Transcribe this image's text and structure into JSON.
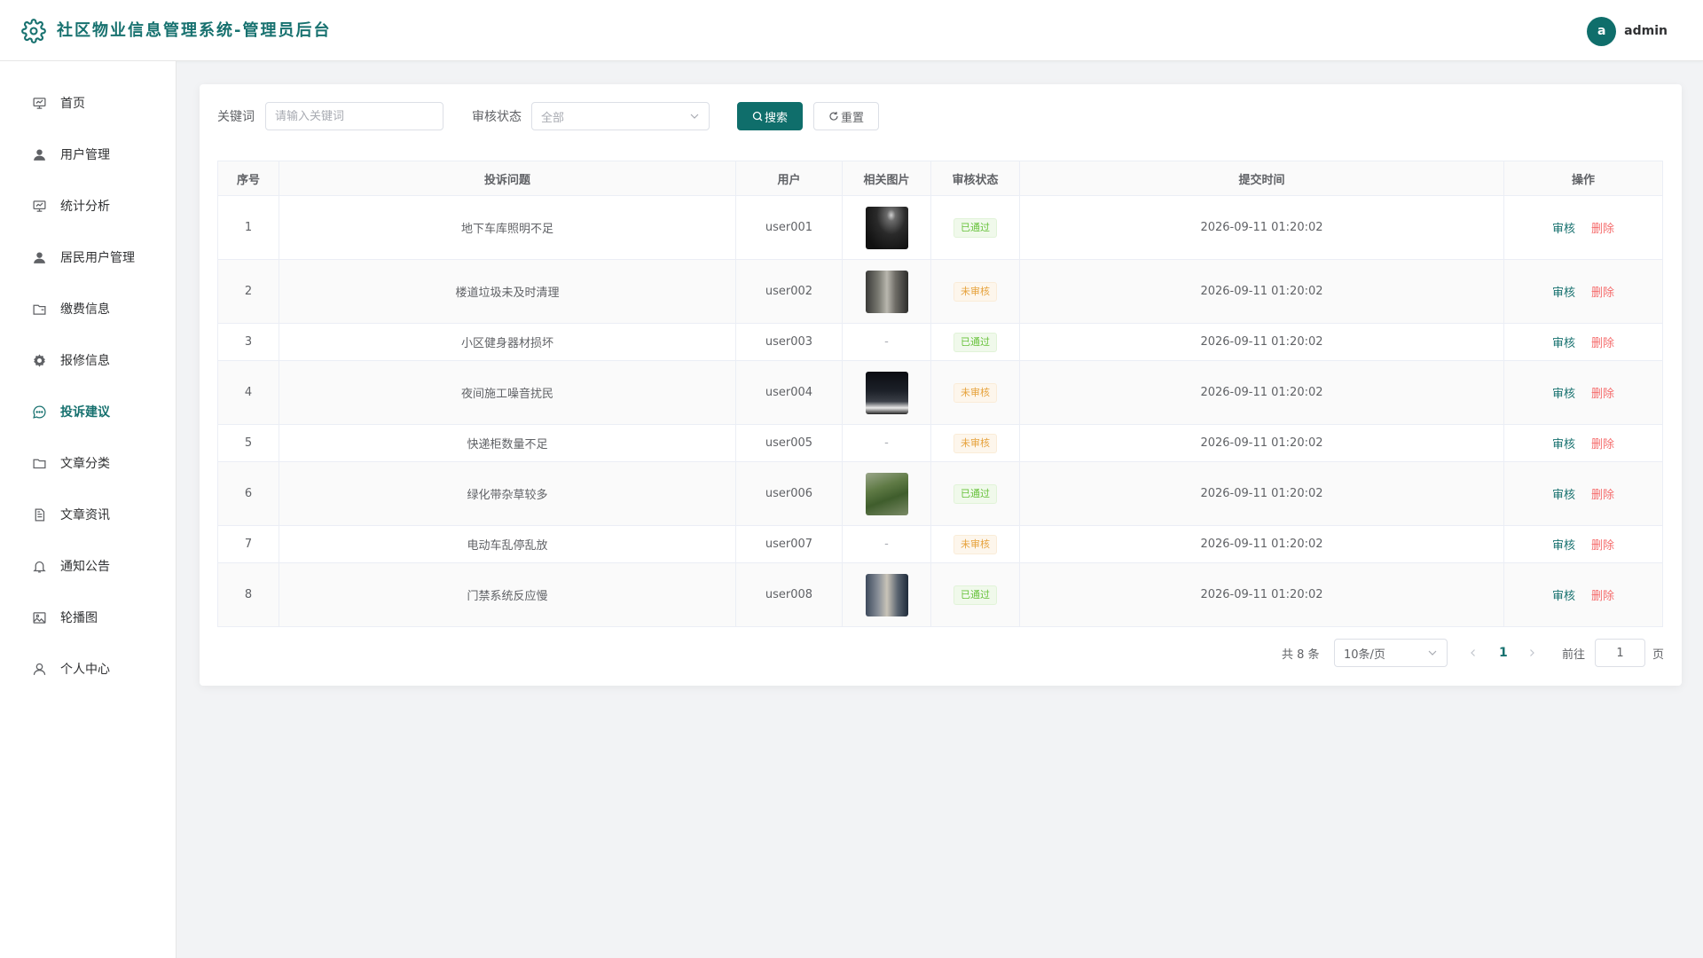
{
  "header": {
    "title": "社区物业信息管理系统-管理员后台",
    "avatar_letter": "a",
    "username": "admin",
    "accent": "#17716f"
  },
  "sidebar": {
    "items": [
      {
        "label": "首页",
        "icon": "monitor-icon"
      },
      {
        "label": "用户管理",
        "icon": "user-icon"
      },
      {
        "label": "统计分析",
        "icon": "chart-icon"
      },
      {
        "label": "居民用户管理",
        "icon": "user-icon"
      },
      {
        "label": "缴费信息",
        "icon": "wallet-icon"
      },
      {
        "label": "报修信息",
        "icon": "gear-icon"
      },
      {
        "label": "投诉建议",
        "icon": "chat-icon",
        "active": true
      },
      {
        "label": "文章分类",
        "icon": "folder-icon"
      },
      {
        "label": "文章资讯",
        "icon": "document-icon"
      },
      {
        "label": "通知公告",
        "icon": "bell-icon"
      },
      {
        "label": "轮播图",
        "icon": "picture-icon"
      },
      {
        "label": "个人中心",
        "icon": "user-outline-icon"
      }
    ]
  },
  "filters": {
    "keyword_label": "关键词",
    "keyword_placeholder": "请输入关键词",
    "status_label": "审核状态",
    "status_value": "全部",
    "search_label": "搜索",
    "reset_label": "重置"
  },
  "table": {
    "columns": [
      "序号",
      "投诉问题",
      "用户",
      "相关图片",
      "审核状态",
      "提交时间",
      "操作"
    ],
    "rows": [
      {
        "no": "1",
        "issue": "地下车库照明不足",
        "user": "user001",
        "image": "dark-garage",
        "status": "已通过",
        "time": "2026-09-11 01:20:02"
      },
      {
        "no": "2",
        "issue": "楼道垃圾未及时清理",
        "user": "user002",
        "image": "hallway",
        "status": "未审核",
        "time": "2026-09-11 01:20:02"
      },
      {
        "no": "3",
        "issue": "小区健身器材损坏",
        "user": "user003",
        "image": "-",
        "status": "已通过",
        "time": "2026-09-11 01:20:02"
      },
      {
        "no": "4",
        "issue": "夜间施工噪音扰民",
        "user": "user004",
        "image": "night-street",
        "status": "未审核",
        "time": "2026-09-11 01:20:02"
      },
      {
        "no": "5",
        "issue": "快递柜数量不足",
        "user": "user005",
        "image": "-",
        "status": "未审核",
        "time": "2026-09-11 01:20:02"
      },
      {
        "no": "6",
        "issue": "绿化带杂草较多",
        "user": "user006",
        "image": "greenery",
        "status": "已通过",
        "time": "2026-09-11 01:20:02"
      },
      {
        "no": "7",
        "issue": "电动车乱停乱放",
        "user": "user007",
        "image": "-",
        "status": "未审核",
        "time": "2026-09-11 01:20:02"
      },
      {
        "no": "8",
        "issue": "门禁系统反应慢",
        "user": "user008",
        "image": "entrance-gate",
        "status": "已通过",
        "time": "2026-09-11 01:20:02"
      }
    ],
    "review_label": "审核",
    "delete_label": "删除"
  },
  "pagination": {
    "total_text": "共 8 条",
    "page_size": "10条/页",
    "current_page": "1",
    "goto_label": "前往",
    "goto_value": "1",
    "page_suffix": "页"
  }
}
